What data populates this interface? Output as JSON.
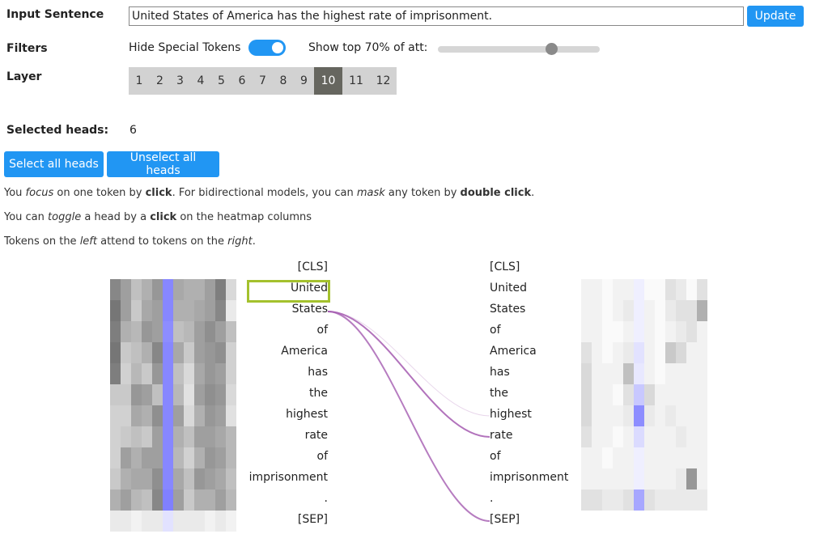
{
  "controls": {
    "input_label": "Input Sentence",
    "sentence": "United States of America has the highest rate of imprisonment.",
    "update_label": "Update",
    "filters_label": "Filters",
    "hide_special_label": "Hide Special Tokens",
    "hide_special_on": true,
    "show_top_label": "Show top 70% of att:",
    "show_top_fraction": 0.7,
    "layer_label": "Layer",
    "layers": [
      "1",
      "2",
      "3",
      "4",
      "5",
      "6",
      "7",
      "8",
      "9",
      "10",
      "11",
      "12"
    ],
    "active_layer": "10"
  },
  "heads": {
    "selected_label": "Selected heads:",
    "selected_count": "6",
    "select_all": "Select all heads",
    "unselect_all": "Unselect all heads"
  },
  "help": {
    "line1": [
      "You ",
      "focus",
      " on one token by ",
      "click",
      ". For bidirectional models, you can ",
      "mask",
      " any token by ",
      "double click",
      "."
    ],
    "line2": [
      "You can ",
      "toggle",
      " a head by a ",
      "click",
      " on the heatmap columns"
    ],
    "line3": [
      "Tokens on the ",
      "left",
      " attend to tokens on the ",
      "right",
      "."
    ]
  },
  "tokens": [
    "[CLS]",
    "United",
    "States",
    "of",
    "America",
    "has",
    "the",
    "highest",
    "rate",
    "of",
    "imprisonment",
    ".",
    "[SEP]"
  ],
  "focused_token_index": 1,
  "attention_links": [
    {
      "from": 1,
      "to": 6,
      "weight": 0.25
    },
    {
      "from": 1,
      "to": 7,
      "weight": 0.85
    },
    {
      "from": 1,
      "to": 11,
      "weight": 0.8
    }
  ],
  "colors": {
    "accent": "#2196f3",
    "focus_border": "#a4c12d",
    "link": "#a45bb0",
    "head_highlight": "#7b7bff",
    "layer_active": "#66665f"
  },
  "left_heatmap": {
    "highlight_col": 5,
    "rows": [
      [
        0.7,
        0.55,
        0.35,
        0.45,
        0.6,
        0.85,
        0.5,
        0.45,
        0.45,
        0.55,
        0.75,
        0.2
      ],
      [
        0.8,
        0.55,
        0.3,
        0.5,
        0.55,
        0.85,
        0.45,
        0.45,
        0.5,
        0.55,
        0.7,
        0.1
      ],
      [
        0.75,
        0.45,
        0.4,
        0.6,
        0.55,
        0.8,
        0.35,
        0.4,
        0.55,
        0.65,
        0.55,
        0.35
      ],
      [
        0.8,
        0.3,
        0.35,
        0.45,
        0.7,
        0.85,
        0.5,
        0.3,
        0.55,
        0.6,
        0.65,
        0.25
      ],
      [
        0.75,
        0.25,
        0.4,
        0.3,
        0.6,
        0.85,
        0.35,
        0.2,
        0.5,
        0.6,
        0.55,
        0.25
      ],
      [
        0.3,
        0.3,
        0.6,
        0.55,
        0.35,
        0.85,
        0.4,
        0.15,
        0.55,
        0.65,
        0.6,
        0.2
      ],
      [
        0.25,
        0.25,
        0.5,
        0.45,
        0.65,
        0.85,
        0.55,
        0.2,
        0.45,
        0.6,
        0.55,
        0.15
      ],
      [
        0.25,
        0.3,
        0.35,
        0.3,
        0.55,
        0.85,
        0.45,
        0.35,
        0.55,
        0.55,
        0.5,
        0.4
      ],
      [
        0.25,
        0.55,
        0.45,
        0.55,
        0.55,
        0.85,
        0.4,
        0.25,
        0.45,
        0.6,
        0.55,
        0.4
      ],
      [
        0.3,
        0.45,
        0.5,
        0.5,
        0.65,
        0.85,
        0.5,
        0.35,
        0.6,
        0.55,
        0.5,
        0.35
      ],
      [
        0.45,
        0.55,
        0.4,
        0.35,
        0.7,
        0.9,
        0.55,
        0.3,
        0.45,
        0.45,
        0.55,
        0.4
      ],
      [
        0.1,
        0.1,
        0.05,
        0.1,
        0.1,
        0.15,
        0.1,
        0.1,
        0.1,
        0.05,
        0.1,
        0.05
      ]
    ]
  },
  "right_heatmap": {
    "highlight_col": 5,
    "rows": [
      [
        0.05,
        0.05,
        0.0,
        0.05,
        0.05,
        0.05,
        0.0,
        0.0,
        0.15,
        0.1,
        0.0,
        0.15
      ],
      [
        0.05,
        0.05,
        0.0,
        0.05,
        0.1,
        0.05,
        0.05,
        0.0,
        0.1,
        0.15,
        0.15,
        0.45
      ],
      [
        0.05,
        0.05,
        0.0,
        0.0,
        0.05,
        0.05,
        0.05,
        0.0,
        0.05,
        0.1,
        0.15,
        0.05
      ],
      [
        0.15,
        0.05,
        0.0,
        0.05,
        0.1,
        0.15,
        0.05,
        0.0,
        0.3,
        0.2,
        0.05,
        0.05
      ],
      [
        0.2,
        0.05,
        0.05,
        0.05,
        0.35,
        0.1,
        0.05,
        0.0,
        0.05,
        0.05,
        0.05,
        0.05
      ],
      [
        0.2,
        0.05,
        0.05,
        0.0,
        0.15,
        0.35,
        0.2,
        0.05,
        0.05,
        0.05,
        0.05,
        0.05
      ],
      [
        0.2,
        0.05,
        0.05,
        0.05,
        0.1,
        0.8,
        0.1,
        0.05,
        0.1,
        0.05,
        0.05,
        0.05
      ],
      [
        0.15,
        0.05,
        0.05,
        0.0,
        0.05,
        0.2,
        0.05,
        0.05,
        0.05,
        0.1,
        0.05,
        0.05
      ],
      [
        0.05,
        0.05,
        0.0,
        0.05,
        0.05,
        0.05,
        0.05,
        0.05,
        0.05,
        0.05,
        0.05,
        0.05
      ],
      [
        0.05,
        0.05,
        0.05,
        0.05,
        0.05,
        0.05,
        0.05,
        0.05,
        0.05,
        0.1,
        0.6,
        0.05
      ],
      [
        0.15,
        0.15,
        0.1,
        0.1,
        0.15,
        0.6,
        0.15,
        0.1,
        0.1,
        0.1,
        0.1,
        0.1
      ]
    ]
  }
}
